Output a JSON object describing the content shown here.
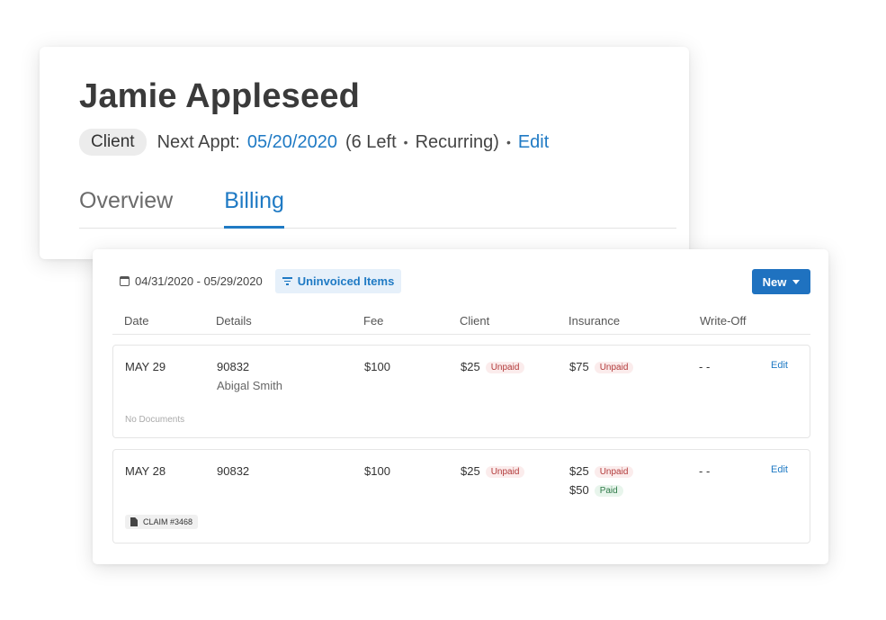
{
  "profile": {
    "name": "Jamie Appleseed",
    "role": "Client",
    "next_appt_label": "Next Appt:",
    "next_appt_date": "05/20/2020",
    "appt_note": "(6 Left",
    "appt_bullet": "•",
    "appt_recurring": "Recurring)",
    "edit_label": "Edit"
  },
  "tabs": [
    {
      "label": "Overview",
      "active": false
    },
    {
      "label": "Billing",
      "active": true
    }
  ],
  "billing": {
    "date_range": "04/31/2020 - 05/29/2020",
    "filter_label": "Uninvoiced Items",
    "new_label": "New",
    "columns": [
      "Date",
      "Details",
      "Fee",
      "Client",
      "Insurance",
      "Write-Off"
    ],
    "rows": [
      {
        "date": "MAY 29",
        "code": "90832",
        "provider": "Abigal Smith",
        "fee": "$100",
        "client_amount": "$25",
        "client_status": "Unpaid",
        "insurance": [
          {
            "amount": "$75",
            "status": "Unpaid"
          }
        ],
        "write_off": "- -",
        "edit_label": "Edit",
        "documents": "No Documents"
      },
      {
        "date": "MAY 28",
        "code": "90832",
        "fee": "$100",
        "client_amount": "$25",
        "client_status": "Unpaid",
        "insurance": [
          {
            "amount": "$25",
            "status": "Unpaid"
          },
          {
            "amount": "$50",
            "status": "Paid"
          }
        ],
        "write_off": "- -",
        "edit_label": "Edit",
        "claim": "CLAIM #3468"
      }
    ]
  },
  "colors": {
    "accent": "#1f7ac4",
    "button": "#1f72c0",
    "unpaid": "#b23a3a",
    "paid": "#2f7a48"
  }
}
